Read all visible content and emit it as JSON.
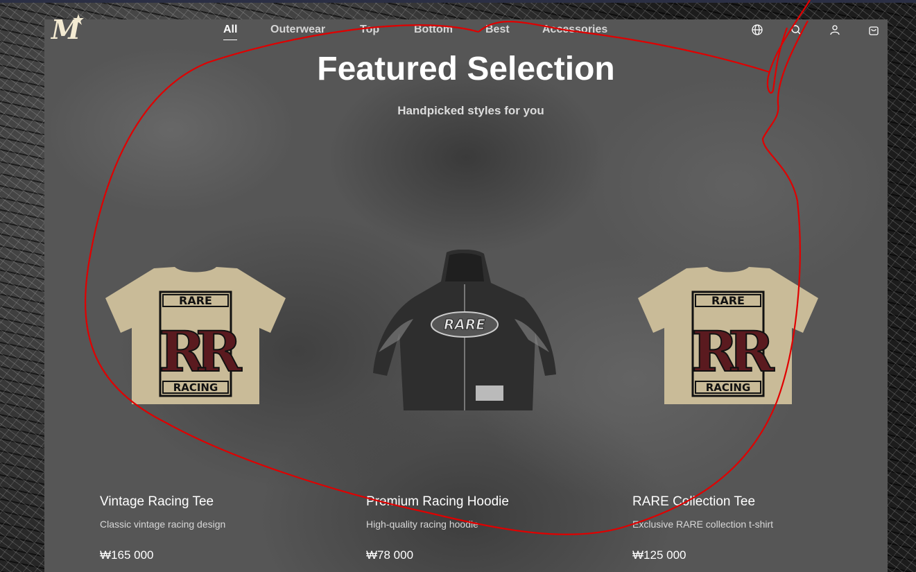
{
  "nav": {
    "logo_text": "M",
    "categories": [
      "All",
      "Outerwear",
      "Top",
      "Bottom",
      "Best",
      "Accessories"
    ],
    "icons": [
      "globe-icon",
      "search-icon",
      "user-icon",
      "cart-icon"
    ]
  },
  "hero": {
    "title": "Featured Selection",
    "subtitle": "Handpicked styles for you"
  },
  "products": [
    {
      "name": "Vintage Racing Tee",
      "description": "Classic vintage racing design",
      "price": "₩165 000",
      "print_top": "RARE",
      "print_monogram": "RR",
      "print_bottom": "RACING"
    },
    {
      "name": "Premium Racing Hoodie",
      "description": "High-quality racing hoodie",
      "price": "₩78 000",
      "print_logo": "RARE"
    },
    {
      "name": "RARE Collection Tee",
      "description": "Exclusive RARE collection t-shirt",
      "price": "₩125 000",
      "print_top": "RARE",
      "print_monogram": "RR",
      "print_bottom": "RACING"
    }
  ],
  "colors": {
    "tee": "#c9bb98",
    "monogram": "#5a1a1f",
    "hoodie": "#2e2e2e",
    "annotation": "#e00000"
  }
}
